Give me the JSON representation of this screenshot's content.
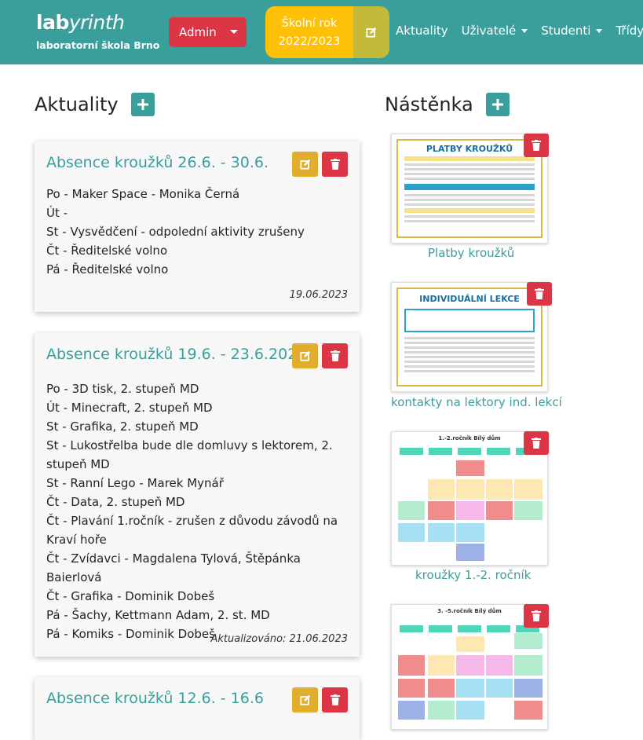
{
  "brand": {
    "logo_main": "lab",
    "logo_italic": "yrinth",
    "subtitle": "laboratorní škola Brno"
  },
  "navbar": {
    "admin_label": "Admin",
    "year_line1": "Školní rok",
    "year_line2": "2022/2023",
    "links": [
      {
        "label": "Aktuality",
        "dropdown": false
      },
      {
        "label": "Uživatelé",
        "dropdown": true
      },
      {
        "label": "Studenti",
        "dropdown": true
      },
      {
        "label": "Třídy",
        "dropdown": true
      }
    ]
  },
  "news": {
    "heading": "Aktuality",
    "cards": [
      {
        "title": "Absence kroužků 26.6. - 30.6.",
        "lines": [
          "Po - Maker Space - Monika Černá",
          "Út -",
          "St - Vysvědčení - odpolední aktivity zrušeny",
          "Čt - Ředitelské volno",
          "Pá - Ředitelské volno"
        ],
        "date": "19.06.2023"
      },
      {
        "title": "Absence kroužků 19.6. - 23.6.2023",
        "lines": [
          "Po - 3D tisk, 2. stupeň MD",
          "Út - Minecraft, 2. stupeň MD",
          "St - Grafika, 2. stupeň MD",
          "St - Lukostřelba bude dle domluvy s lektorem, 2.",
          "stupeň MD",
          "St - Ranní Lego - Marek Mynář",
          "Čt - Data, 2. stupeň MD",
          "Čt - Plavání 1.ročník - zrušen z důvodu závodů na",
          "Kraví hoře",
          "Čt - Zvídavci - Magdalena Tylová, Štěpánka Baierlová",
          "Čt - Grafika - Dominik Dobeš",
          "Pá - Šachy, Kettmann Adam, 2. st. MD",
          "Pá - Komiks - Dominik Dobeš"
        ],
        "date": "Aktualizováno: 21.06.2023"
      },
      {
        "title": "Absence kroužků 12.6. - 16.6",
        "lines": [],
        "date": ""
      }
    ]
  },
  "board": {
    "heading": "Nástěnka",
    "items": [
      {
        "label": "Platby kroužků",
        "poster_title": "PLATBY KROUŽKŮ"
      },
      {
        "label": "kontakty na lektory ind. lekcí",
        "poster_title": "INDIVIDUÁLNÍ LEKCE"
      },
      {
        "label": "kroužky 1.-2. ročník",
        "poster_title": "1.-2.ročník Bílý dům"
      },
      {
        "label": "",
        "poster_title": "3. -5.ročník Bílý dům"
      }
    ]
  },
  "colors": {
    "teal": "#3a9e9b",
    "red": "#dc3545",
    "yellow": "#ffc107",
    "edit_yellow": "#e0ae2c",
    "olive": "#c3ba39"
  }
}
